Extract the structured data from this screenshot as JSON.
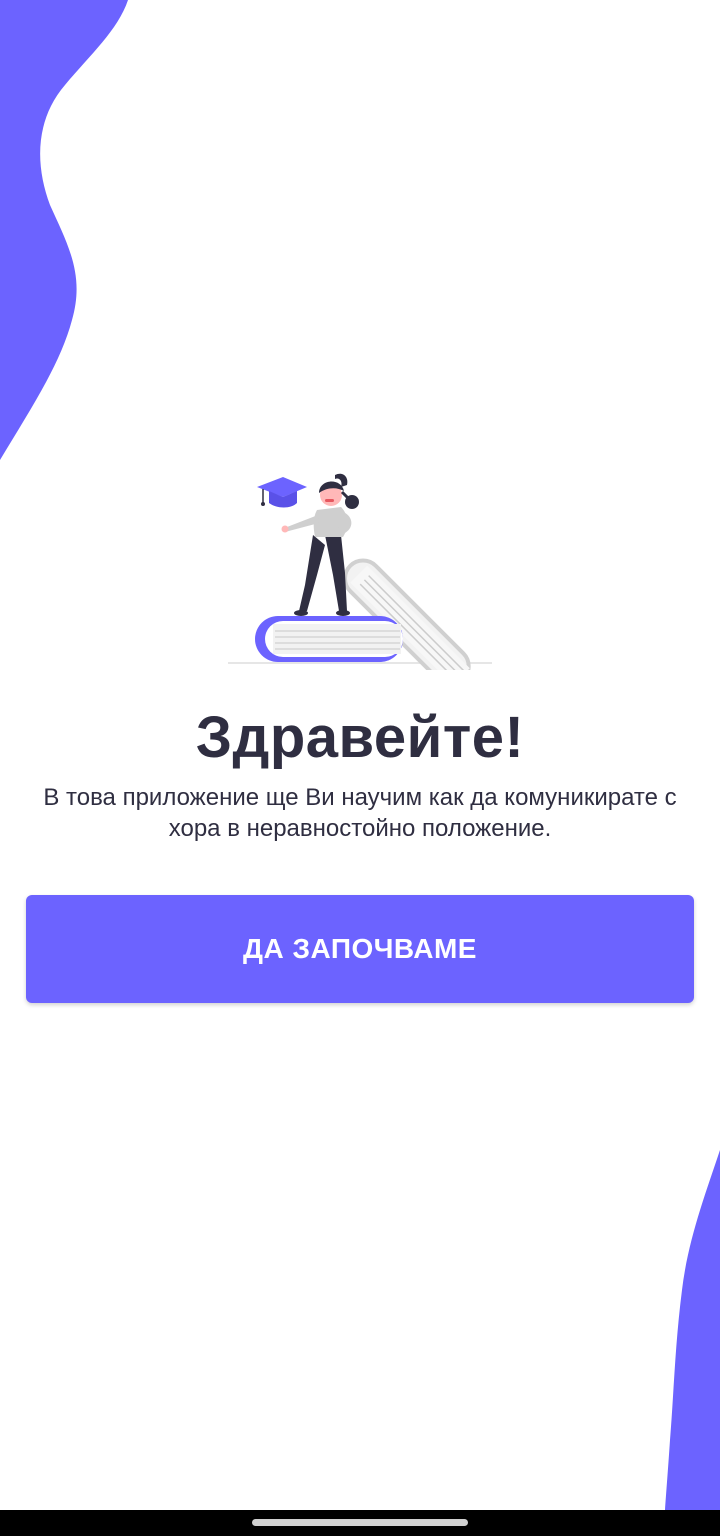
{
  "colors": {
    "accent": "#6c63ff",
    "text": "#2f2e41",
    "background": "#ffffff",
    "navbar": "#000000"
  },
  "welcome": {
    "title": "Здравейте!",
    "subtitle": "В това приложение ще Ви научим как да комуникирате с хора в неравностойно положение.",
    "start_button_label": "ДА ЗАПОЧВАМЕ"
  },
  "illustration": {
    "icon": "woman-on-books-graduation-illustration"
  }
}
